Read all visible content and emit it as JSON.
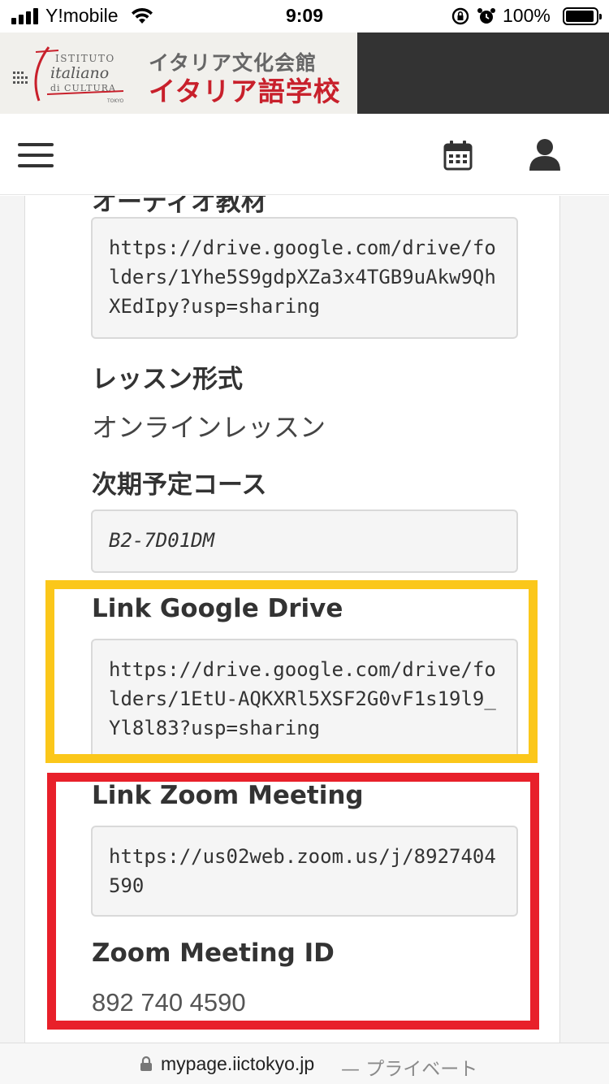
{
  "status_bar": {
    "carrier": "Y!mobile",
    "time": "9:09",
    "battery_percent": "100%",
    "battery_level": 1.0
  },
  "header": {
    "logo_lines": [
      "ISTITUTO",
      "italiano",
      "di CULTURA",
      "TOKYO"
    ],
    "title_line1": "イタリア文化会館",
    "title_line2": "イタリア語学校",
    "brand_red": "#c8202b",
    "dark_panel": "#333333"
  },
  "navbar": {
    "menu_icon": "hamburger-menu-icon",
    "calendar_icon": "calendar-icon",
    "user_icon": "user-icon"
  },
  "content": {
    "partial_label": "オーディオ教材",
    "audio_link": "https://drive.google.com/drive/folders/1Yhe5S9gdpXZa3x4TGB9uAkw9QhXEdIpy?usp=sharing",
    "lesson_format_label": "レッスン形式",
    "lesson_format_value": "オンラインレッスン",
    "next_course_label": "次期予定コース",
    "next_course_value": "B2-7D01DM",
    "google_drive_label": "Link Google Drive",
    "google_drive_value": "https://drive.google.com/drive/folders/1EtU-AQKXRl5XSF2G0vF1s19l9_Yl8l83?usp=sharing",
    "zoom_link_label": "Link Zoom Meeting",
    "zoom_link_value": "https://us02web.zoom.us/j/8927404590",
    "zoom_id_label": "Zoom Meeting ID",
    "zoom_id_value": "892 740 4590",
    "highlight_colors": {
      "yellow": "#fbc71a",
      "red": "#e8202a"
    }
  },
  "url_bar": {
    "domain": "mypage.iictokyo.jp",
    "suffix": "— プライベート"
  }
}
